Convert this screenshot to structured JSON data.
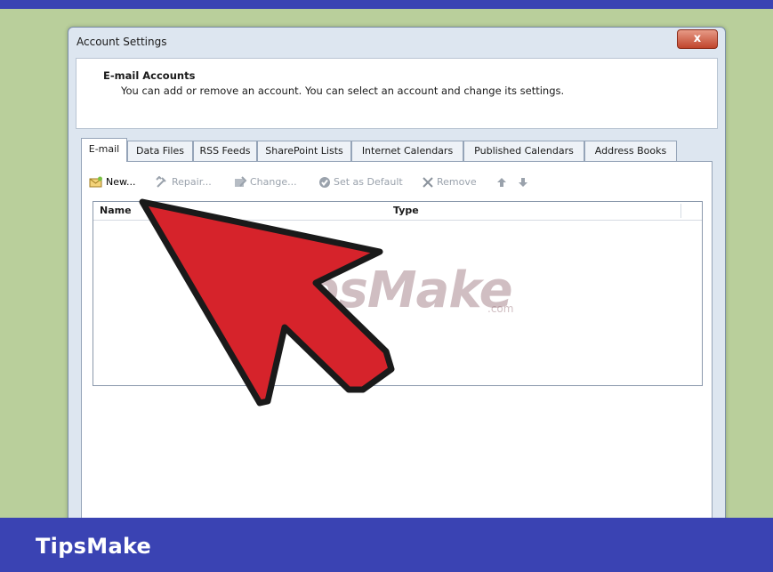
{
  "window": {
    "title": "Account Settings",
    "close_label": "x"
  },
  "header": {
    "title": "E-mail Accounts",
    "subtitle": "You can add or remove an account. You can select an account and change its settings."
  },
  "tabs": [
    {
      "label": "E-mail",
      "active": true
    },
    {
      "label": "Data Files"
    },
    {
      "label": "RSS Feeds"
    },
    {
      "label": "SharePoint Lists"
    },
    {
      "label": "Internet Calendars"
    },
    {
      "label": "Published Calendars"
    },
    {
      "label": "Address Books"
    }
  ],
  "toolbar": {
    "new_label": "New...",
    "repair_label": "Repair...",
    "change_label": "Change...",
    "set_default_label": "Set as Default",
    "remove_label": "Remove",
    "up_icon": "arrow-up-icon",
    "down_icon": "arrow-down-icon"
  },
  "list": {
    "columns": [
      "Name",
      "Type"
    ]
  },
  "watermark": {
    "text": "TipsMake",
    "suffix": ".com"
  },
  "brand": {
    "label": "TipsMake"
  },
  "colors": {
    "frame": "#3a43b3",
    "desktop": "#b9cf9b",
    "arrow": "#d6232b",
    "close": "#c0452c"
  }
}
